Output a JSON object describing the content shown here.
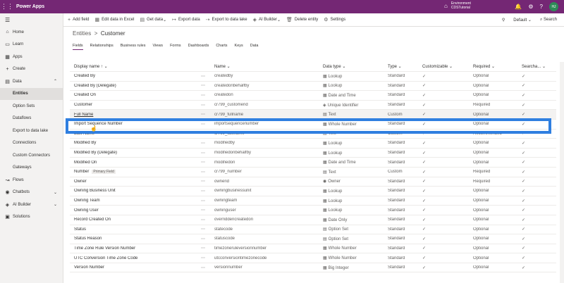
{
  "app": {
    "title": "Power Apps",
    "env_label": "Environment",
    "env_name": "CDSTutorial",
    "avatar": "HJ"
  },
  "sidebar": {
    "items": [
      {
        "label": "Home",
        "icon": "⌂"
      },
      {
        "label": "Learn",
        "icon": "▭"
      },
      {
        "label": "Apps",
        "icon": "▦"
      },
      {
        "label": "Create",
        "icon": "+"
      },
      {
        "label": "Data",
        "icon": "▤",
        "chevron": "⌃"
      },
      {
        "label": "Entities",
        "sub": true,
        "active": true
      },
      {
        "label": "Option Sets",
        "sub": true
      },
      {
        "label": "Dataflows",
        "sub": true
      },
      {
        "label": "Export to data lake",
        "sub": true
      },
      {
        "label": "Connections",
        "sub": true
      },
      {
        "label": "Custom Connectors",
        "sub": true
      },
      {
        "label": "Gateways",
        "sub": true
      },
      {
        "label": "Flows",
        "icon": "↝"
      },
      {
        "label": "Chatbots",
        "icon": "◉",
        "chevron": "⌄"
      },
      {
        "label": "AI Builder",
        "icon": "◈",
        "chevron": "⌄"
      },
      {
        "label": "Solutions",
        "icon": "▣"
      }
    ]
  },
  "toolbar": {
    "items": [
      {
        "label": "Add field",
        "icon": "+"
      },
      {
        "label": "Edit data in Excel",
        "icon": "▦"
      },
      {
        "label": "Get data",
        "icon": "▤",
        "chev": true
      },
      {
        "label": "Export data",
        "icon": "↦"
      },
      {
        "label": "Export to data lake",
        "icon": "⇢"
      },
      {
        "label": "AI Builder",
        "icon": "◈",
        "chev": true
      },
      {
        "label": "Delete entity",
        "icon": "🗑"
      },
      {
        "label": "Settings",
        "icon": "⚙"
      }
    ],
    "default_label": "Default",
    "search_label": "Search"
  },
  "breadcrumb": {
    "parent": "Entities",
    "sep": ">",
    "current": "Customer"
  },
  "tabs": [
    "Fields",
    "Relationships",
    "Business rules",
    "Views",
    "Forms",
    "Dashboards",
    "Charts",
    "Keys",
    "Data"
  ],
  "table": {
    "headers": [
      "Display name ↑ ⌄",
      "Name ⌄",
      "Data type ⌄",
      "Type ⌄",
      "Customizable ⌄",
      "Required ⌄",
      "Searcha... ⌄"
    ],
    "rows": [
      {
        "display": "Created By",
        "name": "createdby",
        "dtype": "Lookup",
        "dicon": "▦",
        "type": "Standard",
        "cust": "✓",
        "req": "Optional",
        "search": "✓"
      },
      {
        "display": "Created By (Delegate)",
        "name": "createdonbehalfby",
        "dtype": "Lookup",
        "dicon": "▦",
        "type": "Standard",
        "cust": "✓",
        "req": "Optional",
        "search": "✓"
      },
      {
        "display": "Created On",
        "name": "createdon",
        "dtype": "Date and Time",
        "dicon": "▦",
        "type": "Standard",
        "cust": "✓",
        "req": "Optional",
        "search": "✓"
      },
      {
        "display": "Customer",
        "name": "cr799_customerid",
        "dtype": "Unique Identifier",
        "dicon": "◈",
        "type": "Standard",
        "cust": "✓",
        "req": "Required",
        "search": "✓"
      },
      {
        "display": "Full Name",
        "name": "cr799_fullname",
        "dtype": "Text",
        "dicon": "▤",
        "type": "Custom",
        "cust": "✓",
        "req": "Optional",
        "search": "✓",
        "selected": true
      },
      {
        "display": "Import Sequence Number",
        "name": "importsequencenumber",
        "dtype": "Whole Number",
        "dicon": "▦",
        "type": "Standard",
        "cust": "✓",
        "req": "Optional",
        "search": "✓"
      },
      {
        "display": "Last Name",
        "name": "cr799_lastname",
        "dtype": "Text",
        "dicon": "▤",
        "type": "Custom",
        "cust": "✓",
        "req": "Recommended",
        "search": "✓"
      },
      {
        "display": "Modified By",
        "name": "modifiedby",
        "dtype": "Lookup",
        "dicon": "▦",
        "type": "Standard",
        "cust": "✓",
        "req": "Optional",
        "search": "✓"
      },
      {
        "display": "Modified By (Delegate)",
        "name": "modifiedonbehalfby",
        "dtype": "Lookup",
        "dicon": "▦",
        "type": "Standard",
        "cust": "✓",
        "req": "Optional",
        "search": "✓"
      },
      {
        "display": "Modified On",
        "name": "modifiedon",
        "dtype": "Date and Time",
        "dicon": "▦",
        "type": "Standard",
        "cust": "✓",
        "req": "Optional",
        "search": "✓"
      },
      {
        "display": "Number",
        "badge": "Primary Field",
        "name": "cr799_number",
        "dtype": "Text",
        "dicon": "▤",
        "type": "Custom",
        "cust": "✓",
        "req": "Required",
        "search": "✓"
      },
      {
        "display": "Owner",
        "name": "ownerid",
        "dtype": "Owner",
        "dicon": "◉",
        "type": "Standard",
        "cust": "✓",
        "req": "Required",
        "search": "✓"
      },
      {
        "display": "Owning Business Unit",
        "name": "owningbusinessunit",
        "dtype": "Lookup",
        "dicon": "▦",
        "type": "Standard",
        "cust": "✓",
        "req": "Optional",
        "search": "✓"
      },
      {
        "display": "Owning Team",
        "name": "owningteam",
        "dtype": "Lookup",
        "dicon": "▦",
        "type": "Standard",
        "cust": "✓",
        "req": "Optional",
        "search": "✓"
      },
      {
        "display": "Owning User",
        "name": "owninguser",
        "dtype": "Lookup",
        "dicon": "▦",
        "type": "Standard",
        "cust": "✓",
        "req": "Optional",
        "search": "✓"
      },
      {
        "display": "Record Created On",
        "name": "overriddencreatedon",
        "dtype": "Date Only",
        "dicon": "▦",
        "type": "Standard",
        "cust": "✓",
        "req": "Optional",
        "search": "✓"
      },
      {
        "display": "Status",
        "name": "statecode",
        "dtype": "Option Set",
        "dicon": "▤",
        "type": "Standard",
        "cust": "✓",
        "req": "Optional",
        "search": "✓"
      },
      {
        "display": "Status Reason",
        "name": "statuscode",
        "dtype": "Option Set",
        "dicon": "▤",
        "type": "Standard",
        "cust": "✓",
        "req": "Optional",
        "search": "✓"
      },
      {
        "display": "Time Zone Rule Version Number",
        "name": "timezoneruleversionnumber",
        "dtype": "Whole Number",
        "dicon": "▦",
        "type": "Standard",
        "cust": "✓",
        "req": "Optional",
        "search": "✓"
      },
      {
        "display": "UTC Conversion Time Zone Code",
        "name": "utcconversiontimezonecode",
        "dtype": "Whole Number",
        "dicon": "▦",
        "type": "Standard",
        "cust": "✓",
        "req": "Optional",
        "search": "✓"
      },
      {
        "display": "Version Number",
        "name": "versionnumber",
        "dtype": "Big Integer",
        "dicon": "▦",
        "type": "Standard",
        "cust": "✓",
        "req": "Optional",
        "search": "✓"
      }
    ]
  }
}
